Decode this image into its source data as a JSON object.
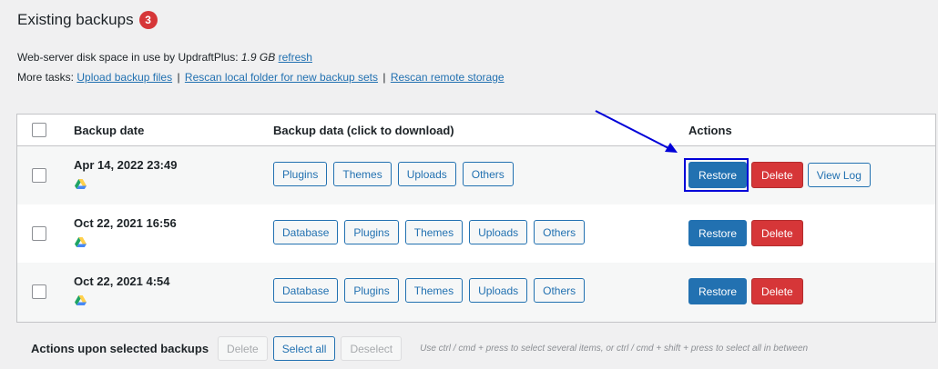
{
  "heading": {
    "title": "Existing backups",
    "count": "3"
  },
  "disk": {
    "label": "Web-server disk space in use by UpdraftPlus:",
    "value": "1.9 GB",
    "refresh": "refresh"
  },
  "tasks": {
    "label": "More tasks:",
    "links": [
      "Upload backup files",
      "Rescan local folder for new backup sets",
      "Rescan remote storage"
    ],
    "separator": "|"
  },
  "table": {
    "headers": {
      "date": "Backup date",
      "data": "Backup data (click to download)",
      "actions": "Actions"
    },
    "rows": [
      {
        "date": "Apr 14, 2022 23:49",
        "data": [
          "Plugins",
          "Themes",
          "Uploads",
          "Others"
        ],
        "actions": [
          "Restore",
          "Delete",
          "View Log"
        ]
      },
      {
        "date": "Oct 22, 2021 16:56",
        "data": [
          "Database",
          "Plugins",
          "Themes",
          "Uploads",
          "Others"
        ],
        "actions": [
          "Restore",
          "Delete"
        ]
      },
      {
        "date": "Oct 22, 2021 4:54",
        "data": [
          "Database",
          "Plugins",
          "Themes",
          "Uploads",
          "Others"
        ],
        "actions": [
          "Restore",
          "Delete"
        ]
      }
    ]
  },
  "footer": {
    "label": "Actions upon selected backups",
    "delete": "Delete",
    "select_all": "Select all",
    "deselect": "Deselect",
    "hint": "Use ctrl / cmd + press to select several items, or ctrl / cmd + shift + press to select all in between"
  },
  "colors": {
    "primary": "#2271b1",
    "danger": "#d63638",
    "highlight": "#0000d8",
    "drive_green": "#1fa463",
    "drive_yellow": "#ffd04b",
    "drive_blue": "#4688f4"
  }
}
